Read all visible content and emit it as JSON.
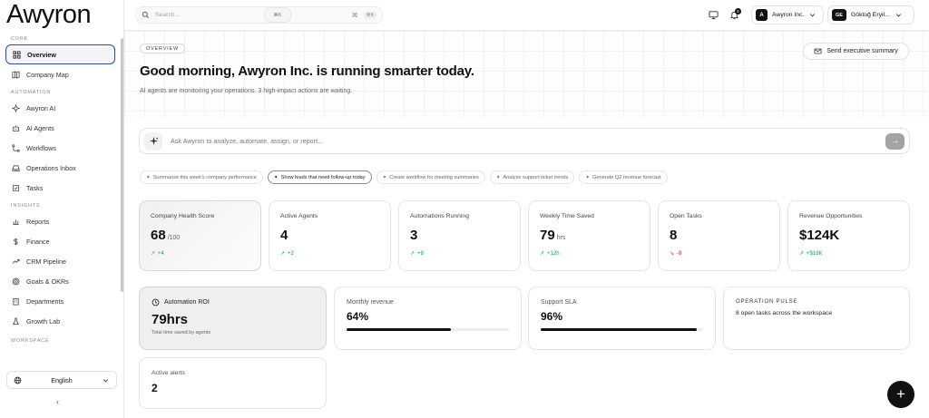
{
  "app": {
    "logo": "Awyron"
  },
  "sidebar": {
    "sections": [
      {
        "title": "CORE",
        "items": [
          {
            "label": "Overview",
            "icon": "grid-icon",
            "active": true
          },
          {
            "label": "Company Map",
            "icon": "map-icon"
          }
        ]
      },
      {
        "title": "AUTOMATION",
        "items": [
          {
            "label": "Awyron AI",
            "icon": "sparkle-icon"
          },
          {
            "label": "AI Agents",
            "icon": "bot-icon"
          },
          {
            "label": "Workflows",
            "icon": "workflow-icon"
          },
          {
            "label": "Operations Inbox",
            "icon": "inbox-icon"
          },
          {
            "label": "Tasks",
            "icon": "checkbox-icon"
          }
        ]
      },
      {
        "title": "INSIGHTS",
        "items": [
          {
            "label": "Reports",
            "icon": "bar-chart-icon"
          },
          {
            "label": "Finance",
            "icon": "dollar-icon"
          },
          {
            "label": "CRM Pipeline",
            "icon": "trend-icon"
          },
          {
            "label": "Goals & OKRs",
            "icon": "target-icon"
          },
          {
            "label": "Departments",
            "icon": "building-icon"
          },
          {
            "label": "Growth Lab",
            "icon": "flask-icon"
          }
        ]
      },
      {
        "title": "WORKSPACE",
        "items": []
      }
    ],
    "language": "English",
    "collapse_glyph": "‹"
  },
  "topbar": {
    "search_placeholder": "Search...",
    "search_kbd_glyph": "⌘",
    "search_kbd": "⌘K",
    "kbd_button": "⌘K",
    "notification_count": "5",
    "org_initial": "A",
    "org_name": "Awyron Inc.",
    "user_initials": "GE",
    "user_name": "Göktuğ Eryil..."
  },
  "header": {
    "pill": "OVERVIEW",
    "headline": "Good morning, Awyron Inc. is running smarter today.",
    "subline": "AI agents are monitoring your operations. 3 high-impact actions are waiting.",
    "exec_button": "Send executive summary"
  },
  "ask": {
    "placeholder": "Ask Awyron to analyze, automate, assign, or report...",
    "go_glyph": "→"
  },
  "chips": [
    {
      "label": "Summarize this week's company performance",
      "selected": false
    },
    {
      "label": "Show leads that need follow-up today",
      "selected": true
    },
    {
      "label": "Create workflow for meeting summaries",
      "selected": false
    },
    {
      "label": "Analyze support ticket trends",
      "selected": false
    },
    {
      "label": "Generate Q2 revenue forecast",
      "selected": false
    }
  ],
  "stats": [
    {
      "title": "Company Health Score",
      "value": "68",
      "unit": "/100",
      "delta": "+4",
      "negative": false
    },
    {
      "title": "Active Agents",
      "value": "4",
      "unit": "",
      "delta": "+2",
      "negative": false
    },
    {
      "title": "Automations Running",
      "value": "3",
      "unit": "",
      "delta": "+8",
      "negative": false
    },
    {
      "title": "Weekly Time Saved",
      "value": "79",
      "unit": "hrs",
      "delta": "+12h",
      "negative": false
    },
    {
      "title": "Open Tasks",
      "value": "8",
      "unit": "",
      "delta": "-8",
      "negative": true
    },
    {
      "title": "Revenue Opportunities",
      "value": "$124K",
      "unit": "",
      "delta": "+$18K",
      "negative": false
    }
  ],
  "roi": {
    "title": "Automation ROI",
    "value": "79hrs",
    "sub": "Total time saved by agents"
  },
  "monthly": {
    "title": "Monthly revenue",
    "value": "64%",
    "progress": 0.64
  },
  "sla": {
    "title": "Support SLA",
    "value": "96%",
    "progress": 0.96
  },
  "pulse": {
    "title": "OPERATION PULSE",
    "text": "8 open tasks across the workspace"
  },
  "alerts": {
    "title": "Active alerts",
    "value": "2"
  },
  "fab": {
    "glyph": "+"
  },
  "colors": {
    "accent": "#2f4d9a",
    "positive": "#16a34a",
    "negative": "#dc2626",
    "dark": "#111111"
  }
}
